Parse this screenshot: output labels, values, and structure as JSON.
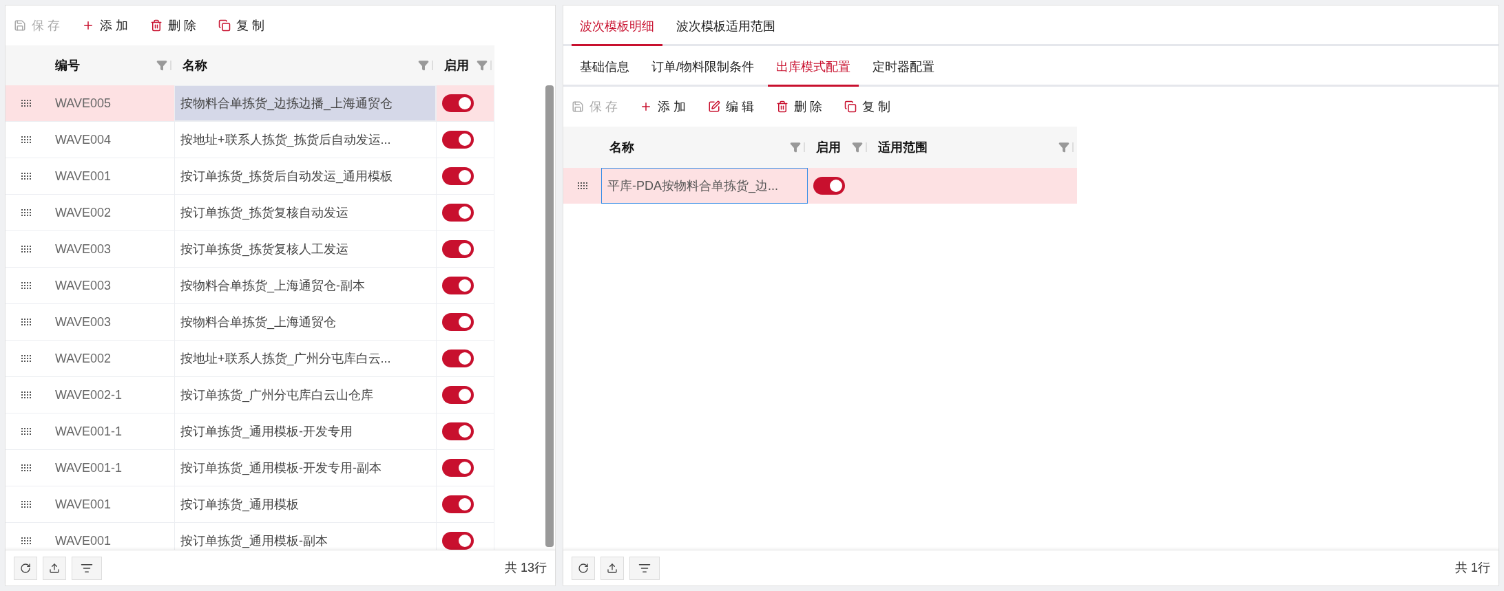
{
  "left": {
    "toolbar": [
      {
        "kind": "save",
        "label": "保 存",
        "disabled": true
      },
      {
        "kind": "add",
        "label": "添 加",
        "disabled": false
      },
      {
        "kind": "delete",
        "label": "删 除",
        "disabled": false
      },
      {
        "kind": "copy",
        "label": "复 制",
        "disabled": false
      }
    ],
    "columns": [
      "编号",
      "名称",
      "启用"
    ],
    "rows": [
      {
        "code": "WAVE005",
        "name": "按物料合单拣货_边拣边播_上海通贸仓",
        "enabled": true,
        "selected": true
      },
      {
        "code": "WAVE004",
        "name": "按地址+联系人拣货_拣货后自动发运...",
        "enabled": true,
        "selected": false
      },
      {
        "code": "WAVE001",
        "name": "按订单拣货_拣货后自动发运_通用模板",
        "enabled": true,
        "selected": false
      },
      {
        "code": "WAVE002",
        "name": "按订单拣货_拣货复核自动发运",
        "enabled": true,
        "selected": false
      },
      {
        "code": "WAVE003",
        "name": "按订单拣货_拣货复核人工发运",
        "enabled": true,
        "selected": false
      },
      {
        "code": "WAVE003",
        "name": "按物料合单拣货_上海通贸仓-副本",
        "enabled": true,
        "selected": false
      },
      {
        "code": "WAVE003",
        "name": "按物料合单拣货_上海通贸仓",
        "enabled": true,
        "selected": false
      },
      {
        "code": "WAVE002",
        "name": "按地址+联系人拣货_广州分屯库白云...",
        "enabled": true,
        "selected": false
      },
      {
        "code": "WAVE002-1",
        "name": "按订单拣货_广州分屯库白云山仓库",
        "enabled": true,
        "selected": false
      },
      {
        "code": "WAVE001-1",
        "name": "按订单拣货_通用模板-开发专用",
        "enabled": true,
        "selected": false
      },
      {
        "code": "WAVE001-1",
        "name": "按订单拣货_通用模板-开发专用-副本",
        "enabled": true,
        "selected": false
      },
      {
        "code": "WAVE001",
        "name": "按订单拣货_通用模板",
        "enabled": true,
        "selected": false
      },
      {
        "code": "WAVE001",
        "name": "按订单拣货_通用模板-副本",
        "enabled": true,
        "selected": false
      }
    ],
    "total": "共 13行"
  },
  "right": {
    "tabs": [
      {
        "label": "波次模板明细",
        "selected": true
      },
      {
        "label": "波次模板适用范围",
        "selected": false
      }
    ],
    "subtabs": [
      {
        "label": "基础信息",
        "selected": false
      },
      {
        "label": "订单/物料限制条件",
        "selected": false
      },
      {
        "label": "出库模式配置",
        "selected": true
      },
      {
        "label": "定时器配置",
        "selected": false
      }
    ],
    "toolbar": [
      {
        "kind": "save",
        "label": "保 存",
        "disabled": true
      },
      {
        "kind": "add",
        "label": "添 加",
        "disabled": false
      },
      {
        "kind": "edit",
        "label": "编 辑",
        "disabled": false
      },
      {
        "kind": "delete",
        "label": "删 除",
        "disabled": false
      },
      {
        "kind": "copy",
        "label": "复 制",
        "disabled": false
      }
    ],
    "columns": [
      "名称",
      "启用",
      "适用范围"
    ],
    "rows": [
      {
        "name": "平库-PDA按物料合单拣货_边...",
        "enabled": true,
        "selected": true
      }
    ],
    "total": "共 1行"
  }
}
